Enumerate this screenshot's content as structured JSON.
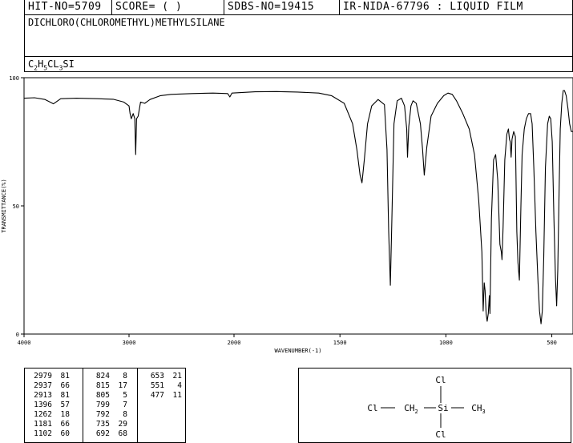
{
  "header": {
    "hit_no": "HIT-NO=5709",
    "score": "SCORE=  (   )",
    "sdbs_no": "SDBS-NO=19415",
    "ir_info": "IR-NIDA-67796 : LIQUID FILM"
  },
  "compound_name": "DICHLORO(CHLOROMETHYL)METHYLSILANE",
  "formula": {
    "p1": "C",
    "s1": "2",
    "p2": "H",
    "s2": "5",
    "p3": "CL",
    "s3": "3",
    "p4": "SI"
  },
  "chart_data": {
    "type": "line",
    "xlabel": "WAVENUMBER(-1)",
    "ylabel": "TRANSMITTANCE(%)",
    "xlim": [
      4000,
      400
    ],
    "ylim": [
      0,
      100
    ],
    "x_ticks": [
      "4000",
      "3000",
      "2000",
      "1500",
      "1000",
      "500"
    ],
    "y_ticks": [
      "100",
      "50",
      "0"
    ],
    "x_tick_values": [
      4000,
      3000,
      2000,
      1500,
      1000,
      500
    ],
    "y_tick_values": [
      100,
      50,
      0
    ],
    "series": [
      {
        "points": [
          [
            4000,
            92
          ],
          [
            3900,
            92.2
          ],
          [
            3800,
            91.5
          ],
          [
            3720,
            89.8
          ],
          [
            3650,
            91.8
          ],
          [
            3500,
            92
          ],
          [
            3300,
            91.8
          ],
          [
            3150,
            91.6
          ],
          [
            3050,
            90.5
          ],
          [
            3000,
            89
          ],
          [
            2990,
            86
          ],
          [
            2979,
            84
          ],
          [
            2960,
            86
          ],
          [
            2945,
            84
          ],
          [
            2937,
            70
          ],
          [
            2928,
            84
          ],
          [
            2913,
            85
          ],
          [
            2890,
            90.5
          ],
          [
            2850,
            90
          ],
          [
            2800,
            91.5
          ],
          [
            2700,
            93
          ],
          [
            2600,
            93.5
          ],
          [
            2400,
            93.8
          ],
          [
            2200,
            94
          ],
          [
            2060,
            93.8
          ],
          [
            2040,
            92.5
          ],
          [
            2020,
            94
          ],
          [
            1900,
            94.5
          ],
          [
            1800,
            94.6
          ],
          [
            1700,
            94.4
          ],
          [
            1600,
            94
          ],
          [
            1540,
            93
          ],
          [
            1480,
            90
          ],
          [
            1440,
            82
          ],
          [
            1420,
            72
          ],
          [
            1405,
            62
          ],
          [
            1396,
            59
          ],
          [
            1385,
            68
          ],
          [
            1370,
            82
          ],
          [
            1350,
            89
          ],
          [
            1320,
            91.5
          ],
          [
            1290,
            89.5
          ],
          [
            1278,
            72
          ],
          [
            1270,
            40
          ],
          [
            1262,
            19
          ],
          [
            1255,
            45
          ],
          [
            1245,
            82
          ],
          [
            1230,
            91
          ],
          [
            1210,
            92
          ],
          [
            1195,
            89
          ],
          [
            1185,
            80
          ],
          [
            1181,
            69
          ],
          [
            1175,
            81
          ],
          [
            1165,
            89
          ],
          [
            1155,
            91
          ],
          [
            1140,
            90
          ],
          [
            1120,
            82
          ],
          [
            1110,
            72
          ],
          [
            1102,
            62
          ],
          [
            1090,
            73
          ],
          [
            1070,
            85
          ],
          [
            1040,
            90
          ],
          [
            1010,
            93
          ],
          [
            990,
            94
          ],
          [
            970,
            93.5
          ],
          [
            950,
            91
          ],
          [
            920,
            86
          ],
          [
            890,
            80
          ],
          [
            865,
            70
          ],
          [
            845,
            52
          ],
          [
            830,
            32
          ],
          [
            824,
            9
          ],
          [
            819,
            20
          ],
          [
            815,
            17
          ],
          [
            810,
            8
          ],
          [
            805,
            5
          ],
          [
            800,
            8
          ],
          [
            795,
            15
          ],
          [
            792,
            8
          ],
          [
            785,
            45
          ],
          [
            775,
            68
          ],
          [
            765,
            70
          ],
          [
            755,
            60
          ],
          [
            745,
            35
          ],
          [
            738,
            32
          ],
          [
            735,
            29
          ],
          [
            730,
            42
          ],
          [
            722,
            68
          ],
          [
            712,
            78
          ],
          [
            705,
            80
          ],
          [
            700,
            76
          ],
          [
            696,
            75
          ],
          [
            692,
            69
          ],
          [
            688,
            76
          ],
          [
            680,
            79
          ],
          [
            672,
            77
          ],
          [
            665,
            40
          ],
          [
            660,
            28
          ],
          [
            653,
            21
          ],
          [
            646,
            50
          ],
          [
            640,
            70
          ],
          [
            630,
            80
          ],
          [
            620,
            84
          ],
          [
            610,
            86
          ],
          [
            600,
            86
          ],
          [
            593,
            82
          ],
          [
            585,
            65
          ],
          [
            575,
            40
          ],
          [
            565,
            20
          ],
          [
            558,
            9
          ],
          [
            551,
            4
          ],
          [
            545,
            9
          ],
          [
            538,
            30
          ],
          [
            530,
            65
          ],
          [
            520,
            82
          ],
          [
            512,
            85
          ],
          [
            505,
            84
          ],
          [
            498,
            75
          ],
          [
            490,
            45
          ],
          [
            483,
            22
          ],
          [
            477,
            11
          ],
          [
            472,
            25
          ],
          [
            466,
            55
          ],
          [
            460,
            80
          ],
          [
            453,
            90
          ],
          [
            446,
            95
          ],
          [
            440,
            95
          ],
          [
            432,
            93
          ],
          [
            424,
            88
          ],
          [
            416,
            82
          ],
          [
            408,
            79
          ],
          [
            400,
            79
          ]
        ]
      }
    ],
    "peak_table": [
      [
        [
          "2979",
          "81"
        ],
        [
          "2937",
          "66"
        ],
        [
          "2913",
          "81"
        ],
        [
          "1396",
          "57"
        ],
        [
          "1262",
          "18"
        ],
        [
          "1181",
          "66"
        ],
        [
          "1102",
          "60"
        ]
      ],
      [
        [
          "824",
          "8"
        ],
        [
          "815",
          "17"
        ],
        [
          "805",
          "5"
        ],
        [
          "799",
          "7"
        ],
        [
          "792",
          "8"
        ],
        [
          "735",
          "29"
        ],
        [
          "692",
          "68"
        ]
      ],
      [
        [
          "653",
          "21"
        ],
        [
          "551",
          "4"
        ],
        [
          "477",
          "11"
        ]
      ]
    ]
  },
  "structure": {
    "cl_top": "Cl",
    "cl_left": "Cl",
    "ch2": "CH",
    "ch2_sub": "2",
    "si": "Si",
    "ch3": "CH",
    "ch3_sub": "3",
    "cl_bottom": "Cl"
  }
}
